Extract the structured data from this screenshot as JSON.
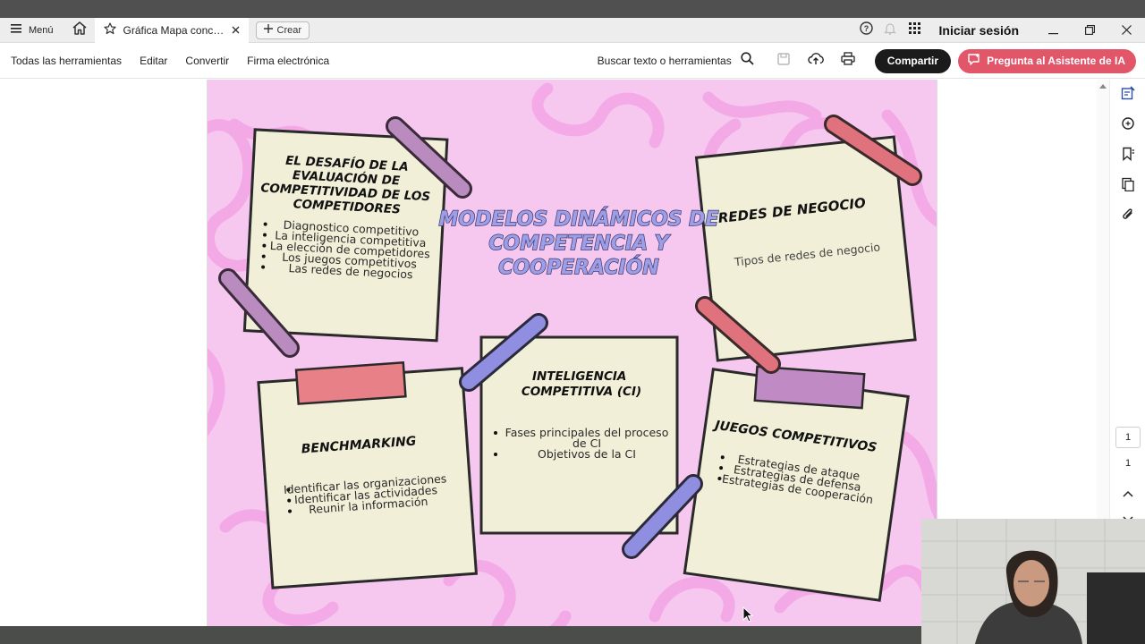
{
  "titlebar": {
    "menu_label": "Menú",
    "tab_title": "Gráfica Mapa concept...",
    "create_label": "Crear",
    "signin_label": "Iniciar sesión"
  },
  "toolbar": {
    "links": [
      "Todas las herramientas",
      "Editar",
      "Convertir",
      "Firma electrónica"
    ],
    "search_label": "Buscar texto o herramientas",
    "share_label": "Compartir",
    "ai_label": "Pregunta al Asistente de IA"
  },
  "document": {
    "title_lines": [
      "MODELOS DINÁMICOS DE",
      "COMPETENCIA Y",
      "COOPERACIÓN"
    ],
    "note_challenge": {
      "heading": [
        "EL DESAFÍO DE LA",
        "EVALUACIÓN DE",
        "COMPETITIVIDAD DE LOS",
        "COMPETIDORES"
      ],
      "items": [
        "Diagnostico competitivo",
        "La inteligencia competitiva",
        "La elección de competidores",
        "Los juegos competitivos",
        "Las redes de negocios"
      ]
    },
    "note_networks": {
      "heading": "REDES DE NEGOCIO",
      "items": [
        "Tipos de redes de negocio"
      ]
    },
    "note_benchmark": {
      "heading": "BENCHMARKING",
      "items": [
        "Identificar las organizaciones",
        "Identificar las actividades",
        "Reunir la información"
      ]
    },
    "note_intel": {
      "heading": [
        "INTELIGENCIA",
        "COMPETITIVA (CI)"
      ],
      "items": [
        "Fases principales del proceso",
        "de CI",
        "Objetivos de la CI"
      ]
    },
    "note_games": {
      "heading": "JUEGOS COMPETITIVOS",
      "items": [
        "Estrategias de ataque",
        "Estrategias de defensa",
        "Estrategias de cooperación"
      ]
    }
  },
  "pagination": {
    "current": "1",
    "total": "1"
  },
  "colors": {
    "page_bg": "#f7c8ef",
    "note_bg": "#f1efd7",
    "tape_purple": "#b98bbf",
    "tape_red": "#e0727d",
    "tape_blue": "#8f8ee0",
    "ai_button": "#e2566a",
    "share_button": "#1b1b1b"
  }
}
